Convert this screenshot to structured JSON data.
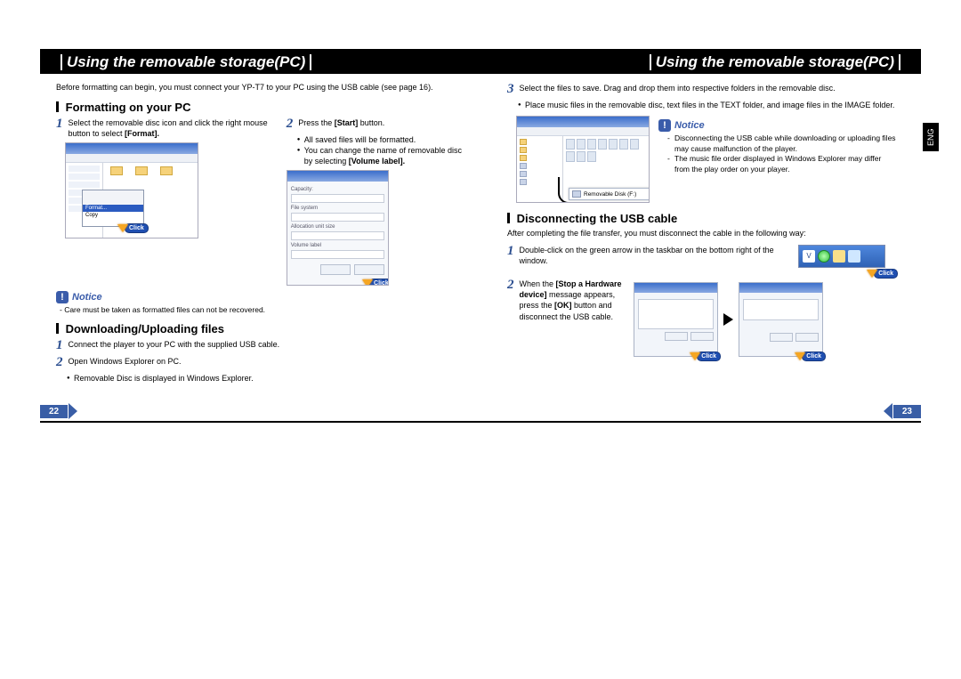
{
  "header": {
    "left_title": "Using the removable storage(PC)",
    "right_title": "Using the removable storage(PC)"
  },
  "left_page": {
    "intro": "Before formatting can begin, you must connect your YP-T7 to your PC using the USB cable (see page 16).",
    "section1_title": "Formatting on your PC",
    "step1": "Select the removable disc icon and click the right mouse button to select ",
    "step1_bold": "[Format].",
    "step2_pre": "Press the ",
    "step2_bold": "[Start]",
    "step2_post": " button.",
    "bullet2a": "All saved files will be formatted.",
    "bullet2b_pre": "You can change the name of removable disc by selecting ",
    "bullet2b_bold": "[Volume label].",
    "ctx_format": "Format...",
    "ctx_copy": "Copy",
    "click_label": "Click",
    "notice_label": "Notice",
    "notice1": "- Care must be taken as formatted files can not be recovered.",
    "section2_title": "Downloading/Uploading files",
    "step_d1": "Connect the player to your PC with the supplied USB cable.",
    "step_d2": "Open Windows Explorer on PC.",
    "bullet_d2": "Removable Disc is displayed in Windows Explorer.",
    "page_num": "22"
  },
  "right_page": {
    "step3a": "Select the files to save. Drag and drop them into respective folders in the removable disc.",
    "bullet3a": "Place music files in the removable disc, text files in the TEXT folder, and image files in the IMAGE folder.",
    "removable_label": "Removable Disk (F:)",
    "notice_label": "Notice",
    "notice_dash1": "Disconnecting the USB cable while downloading or uploading files may cause malfunction of the player.",
    "notice_dash2": "The music file order displayed in Windows Explorer may differ from the play order on your player.",
    "section_title": "Disconnecting the USB cable",
    "sub_intro": "After completing the file transfer, you must disconnect the cable in the following way:",
    "step1": "Double-click on the green arrow in the taskbar on the bottom right of the window.",
    "step2_pre": "When the ",
    "step2_bold1": "[Stop a Hardware device]",
    "step2_mid": " message appears, press the ",
    "step2_bold2": "[OK]",
    "step2_post": " button and disconnect the USB cable.",
    "click_label": "Click",
    "eng_tab": "ENG",
    "page_num": "23"
  }
}
